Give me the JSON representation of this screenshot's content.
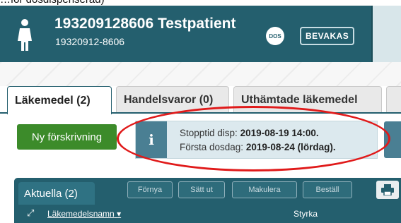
{
  "top_caption": "…för dosdispenserad)",
  "patient": {
    "name": "193209128606 Testpatient",
    "personnummer": "19320912-8606",
    "dos_badge": "DOS",
    "bevakas_badge": "BEVAKAS",
    "icon": "patient-female-icon"
  },
  "tabs": [
    {
      "label": "Läkemedel (2)",
      "active": true
    },
    {
      "label": "Handelsvaror (0)",
      "active": false
    },
    {
      "label": "Uthämtade läkemedel",
      "active": false
    }
  ],
  "new_prescription_button": "Ny förskrivning",
  "info": {
    "icon": "info-icon",
    "line1_label": "Stopptid disp: ",
    "line1_value": "2019-08-19 14:00.",
    "line2_label": "Första dosdag: ",
    "line2_value": "2019-08-24 (lördag)."
  },
  "subtab": "Aktuella (2)",
  "toolbar": {
    "renew": "Förnya",
    "set_out": "Sätt ut",
    "cancel": "Makulera",
    "order": "Beställ",
    "print_icon": "print-icon"
  },
  "table": {
    "columns": [
      "Läkemedelsnamn",
      "Styrka"
    ],
    "sort_icon": "caret-down-icon",
    "expand_icon": "expand-icon"
  },
  "colors": {
    "header": "#245f6e",
    "new_button": "#3c8b2a",
    "info_bg": "#dce9ee",
    "highlight": "#e01a1a"
  }
}
